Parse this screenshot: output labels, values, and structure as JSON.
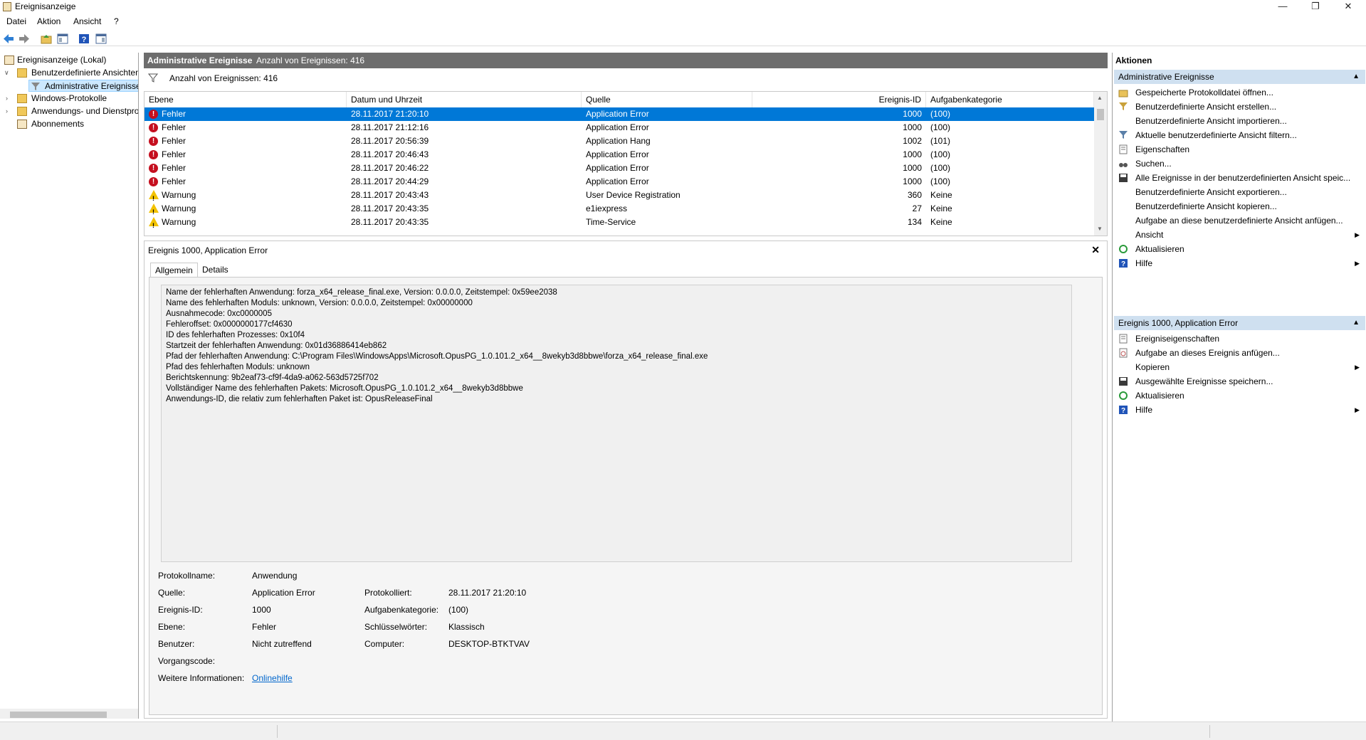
{
  "window": {
    "title": "Ereignisanzeige"
  },
  "menu": [
    "Datei",
    "Aktion",
    "Ansicht",
    "?"
  ],
  "tree": {
    "root": "Ereignisanzeige (Lokal)",
    "custom_views": "Benutzerdefinierte Ansichten",
    "admin_events": "Administrative Ereignisse",
    "windows_logs": "Windows-Protokolle",
    "app_service_logs": "Anwendungs- und Dienstprotokolle",
    "subscriptions": "Abonnements"
  },
  "center": {
    "header_title": "Administrative Ereignisse",
    "header_count": "Anzahl von Ereignissen: 416",
    "filter_text": "Anzahl von Ereignissen: 416",
    "columns": [
      "Ebene",
      "Datum und Uhrzeit",
      "Quelle",
      "Ereignis-ID",
      "Aufgabenkategorie"
    ],
    "rows": [
      {
        "level": "Fehler",
        "type": "error",
        "date": "28.11.2017 21:20:10",
        "source": "Application Error",
        "id": "1000",
        "cat": "(100)"
      },
      {
        "level": "Fehler",
        "type": "error",
        "date": "28.11.2017 21:12:16",
        "source": "Application Error",
        "id": "1000",
        "cat": "(100)"
      },
      {
        "level": "Fehler",
        "type": "error",
        "date": "28.11.2017 20:56:39",
        "source": "Application Hang",
        "id": "1002",
        "cat": "(101)"
      },
      {
        "level": "Fehler",
        "type": "error",
        "date": "28.11.2017 20:46:43",
        "source": "Application Error",
        "id": "1000",
        "cat": "(100)"
      },
      {
        "level": "Fehler",
        "type": "error",
        "date": "28.11.2017 20:46:22",
        "source": "Application Error",
        "id": "1000",
        "cat": "(100)"
      },
      {
        "level": "Fehler",
        "type": "error",
        "date": "28.11.2017 20:44:29",
        "source": "Application Error",
        "id": "1000",
        "cat": "(100)"
      },
      {
        "level": "Warnung",
        "type": "warning",
        "date": "28.11.2017 20:43:43",
        "source": "User Device Registration",
        "id": "360",
        "cat": "Keine"
      },
      {
        "level": "Warnung",
        "type": "warning",
        "date": "28.11.2017 20:43:35",
        "source": "e1iexpress",
        "id": "27",
        "cat": "Keine"
      },
      {
        "level": "Warnung",
        "type": "warning",
        "date": "28.11.2017 20:43:35",
        "source": "Time-Service",
        "id": "134",
        "cat": "Keine"
      }
    ]
  },
  "detail": {
    "title": "Ereignis 1000, Application Error",
    "tabs": [
      "Allgemein",
      "Details"
    ],
    "description": "Name der fehlerhaften Anwendung: forza_x64_release_final.exe, Version: 0.0.0.0, Zeitstempel: 0x59ee2038\nName des fehlerhaften Moduls: unknown, Version: 0.0.0.0, Zeitstempel: 0x00000000\nAusnahmecode: 0xc0000005\nFehleroffset: 0x0000000177cf4630\nID des fehlerhaften Prozesses: 0x10f4\nStartzeit der fehlerhaften Anwendung: 0x01d36886414eb862\nPfad der fehlerhaften Anwendung: C:\\Program Files\\WindowsApps\\Microsoft.OpusPG_1.0.101.2_x64__8wekyb3d8bbwe\\forza_x64_release_final.exe\nPfad des fehlerhaften Moduls: unknown\nBerichtskennung: 9b2eaf73-cf9f-4da9-a062-563d5725f702\nVollständiger Name des fehlerhaften Pakets: Microsoft.OpusPG_1.0.101.2_x64__8wekyb3d8bbwe\nAnwendungs-ID, die relativ zum fehlerhaften Paket ist: OpusReleaseFinal",
    "props": {
      "log_name_label": "Protokollname:",
      "log_name": "Anwendung",
      "source_label": "Quelle:",
      "source": "Application Error",
      "logged_label": "Protokolliert:",
      "logged": "28.11.2017 21:20:10",
      "event_id_label": "Ereignis-ID:",
      "event_id": "1000",
      "task_cat_label": "Aufgabenkategorie:",
      "task_cat": "(100)",
      "level_label": "Ebene:",
      "level": "Fehler",
      "keywords_label": "Schlüsselwörter:",
      "keywords": "Klassisch",
      "user_label": "Benutzer:",
      "user": "Nicht zutreffend",
      "computer_label": "Computer:",
      "computer": "DESKTOP-BTKTVAV",
      "opcode_label": "Vorgangscode:",
      "more_info_label": "Weitere Informationen:",
      "more_info_link": "Onlinehilfe"
    }
  },
  "actions": {
    "title": "Aktionen",
    "section1": "Administrative Ereignisse",
    "items1": [
      {
        "label": "Gespeicherte Protokolldatei öffnen...",
        "icon": "folder-open-icon"
      },
      {
        "label": "Benutzerdefinierte Ansicht erstellen...",
        "icon": "filter-create-icon"
      },
      {
        "label": "Benutzerdefinierte Ansicht importieren...",
        "icon": ""
      },
      {
        "label": "Aktuelle benutzerdefinierte Ansicht filtern...",
        "icon": "filter-icon"
      },
      {
        "label": "Eigenschaften",
        "icon": "properties-icon"
      },
      {
        "label": "Suchen...",
        "icon": "binoculars-icon"
      },
      {
        "label": "Alle Ereignisse in der benutzerdefinierten Ansicht speic...",
        "icon": "save-icon"
      },
      {
        "label": "Benutzerdefinierte Ansicht exportieren...",
        "icon": ""
      },
      {
        "label": "Benutzerdefinierte Ansicht kopieren...",
        "icon": ""
      },
      {
        "label": "Aufgabe an diese benutzerdefinierte Ansicht anfügen...",
        "icon": ""
      },
      {
        "label": "Ansicht",
        "icon": "",
        "submenu": true
      },
      {
        "label": "Aktualisieren",
        "icon": "refresh-icon"
      },
      {
        "label": "Hilfe",
        "icon": "help-icon",
        "submenu": true
      }
    ],
    "section2": "Ereignis 1000, Application Error",
    "items2": [
      {
        "label": "Ereigniseigenschaften",
        "icon": "properties-icon"
      },
      {
        "label": "Aufgabe an dieses Ereignis anfügen...",
        "icon": "task-icon"
      },
      {
        "label": "Kopieren",
        "icon": "",
        "submenu": true
      },
      {
        "label": "Ausgewählte Ereignisse speichern...",
        "icon": "save-icon"
      },
      {
        "label": "Aktualisieren",
        "icon": "refresh-icon"
      },
      {
        "label": "Hilfe",
        "icon": "help-icon",
        "submenu": true
      }
    ]
  }
}
